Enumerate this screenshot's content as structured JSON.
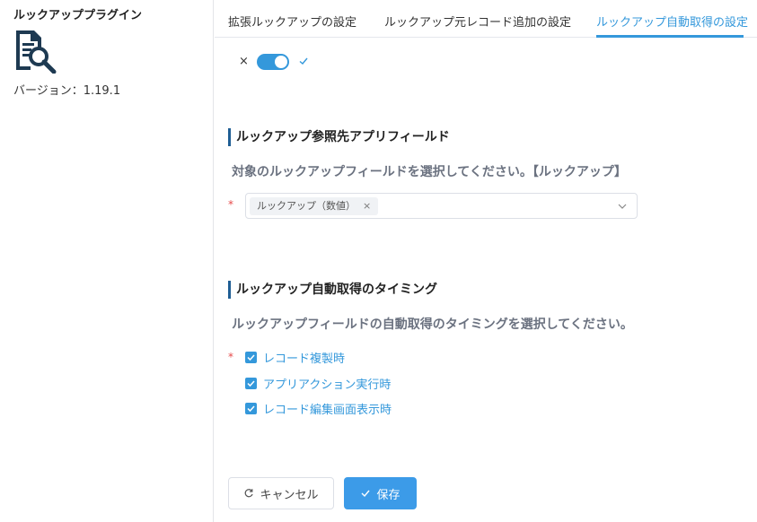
{
  "sidebar": {
    "title": "ルックアッププラグイン",
    "icon": "document-search-icon",
    "version": "バージョン：1.19.1"
  },
  "tabs": [
    {
      "label": "拡張ルックアップの設定",
      "active": false
    },
    {
      "label": "ルックアップ元レコード追加の設定",
      "active": false
    },
    {
      "label": "ルックアップ自動取得の設定",
      "active": true
    }
  ],
  "toggle": {
    "off_symbol": "×",
    "enabled": true
  },
  "section_lookup": {
    "title": "ルックアップ参照先アプリフィールド",
    "description": "対象のルックアップフィールドを選択してください。【ルックアップ】",
    "required_mark": "*",
    "selected_tag": "ルックアップ（数値）",
    "tag_close": "×"
  },
  "section_timing": {
    "title": "ルックアップ自動取得のタイミング",
    "description": "ルックアップフィールドの自動取得のタイミングを選択してください。",
    "required_mark": "*",
    "options": [
      {
        "label": "レコード複製時",
        "checked": true
      },
      {
        "label": "アプリアクション実行時",
        "checked": true
      },
      {
        "label": "レコード編集画面表示時",
        "checked": true
      }
    ]
  },
  "buttons": {
    "cancel_label": "キャンセル",
    "save_label": "保存"
  },
  "colors": {
    "accent": "#3498db",
    "section_bar": "#1f5e94",
    "required": "#e64a4a",
    "save_button": "#3c9be8"
  }
}
